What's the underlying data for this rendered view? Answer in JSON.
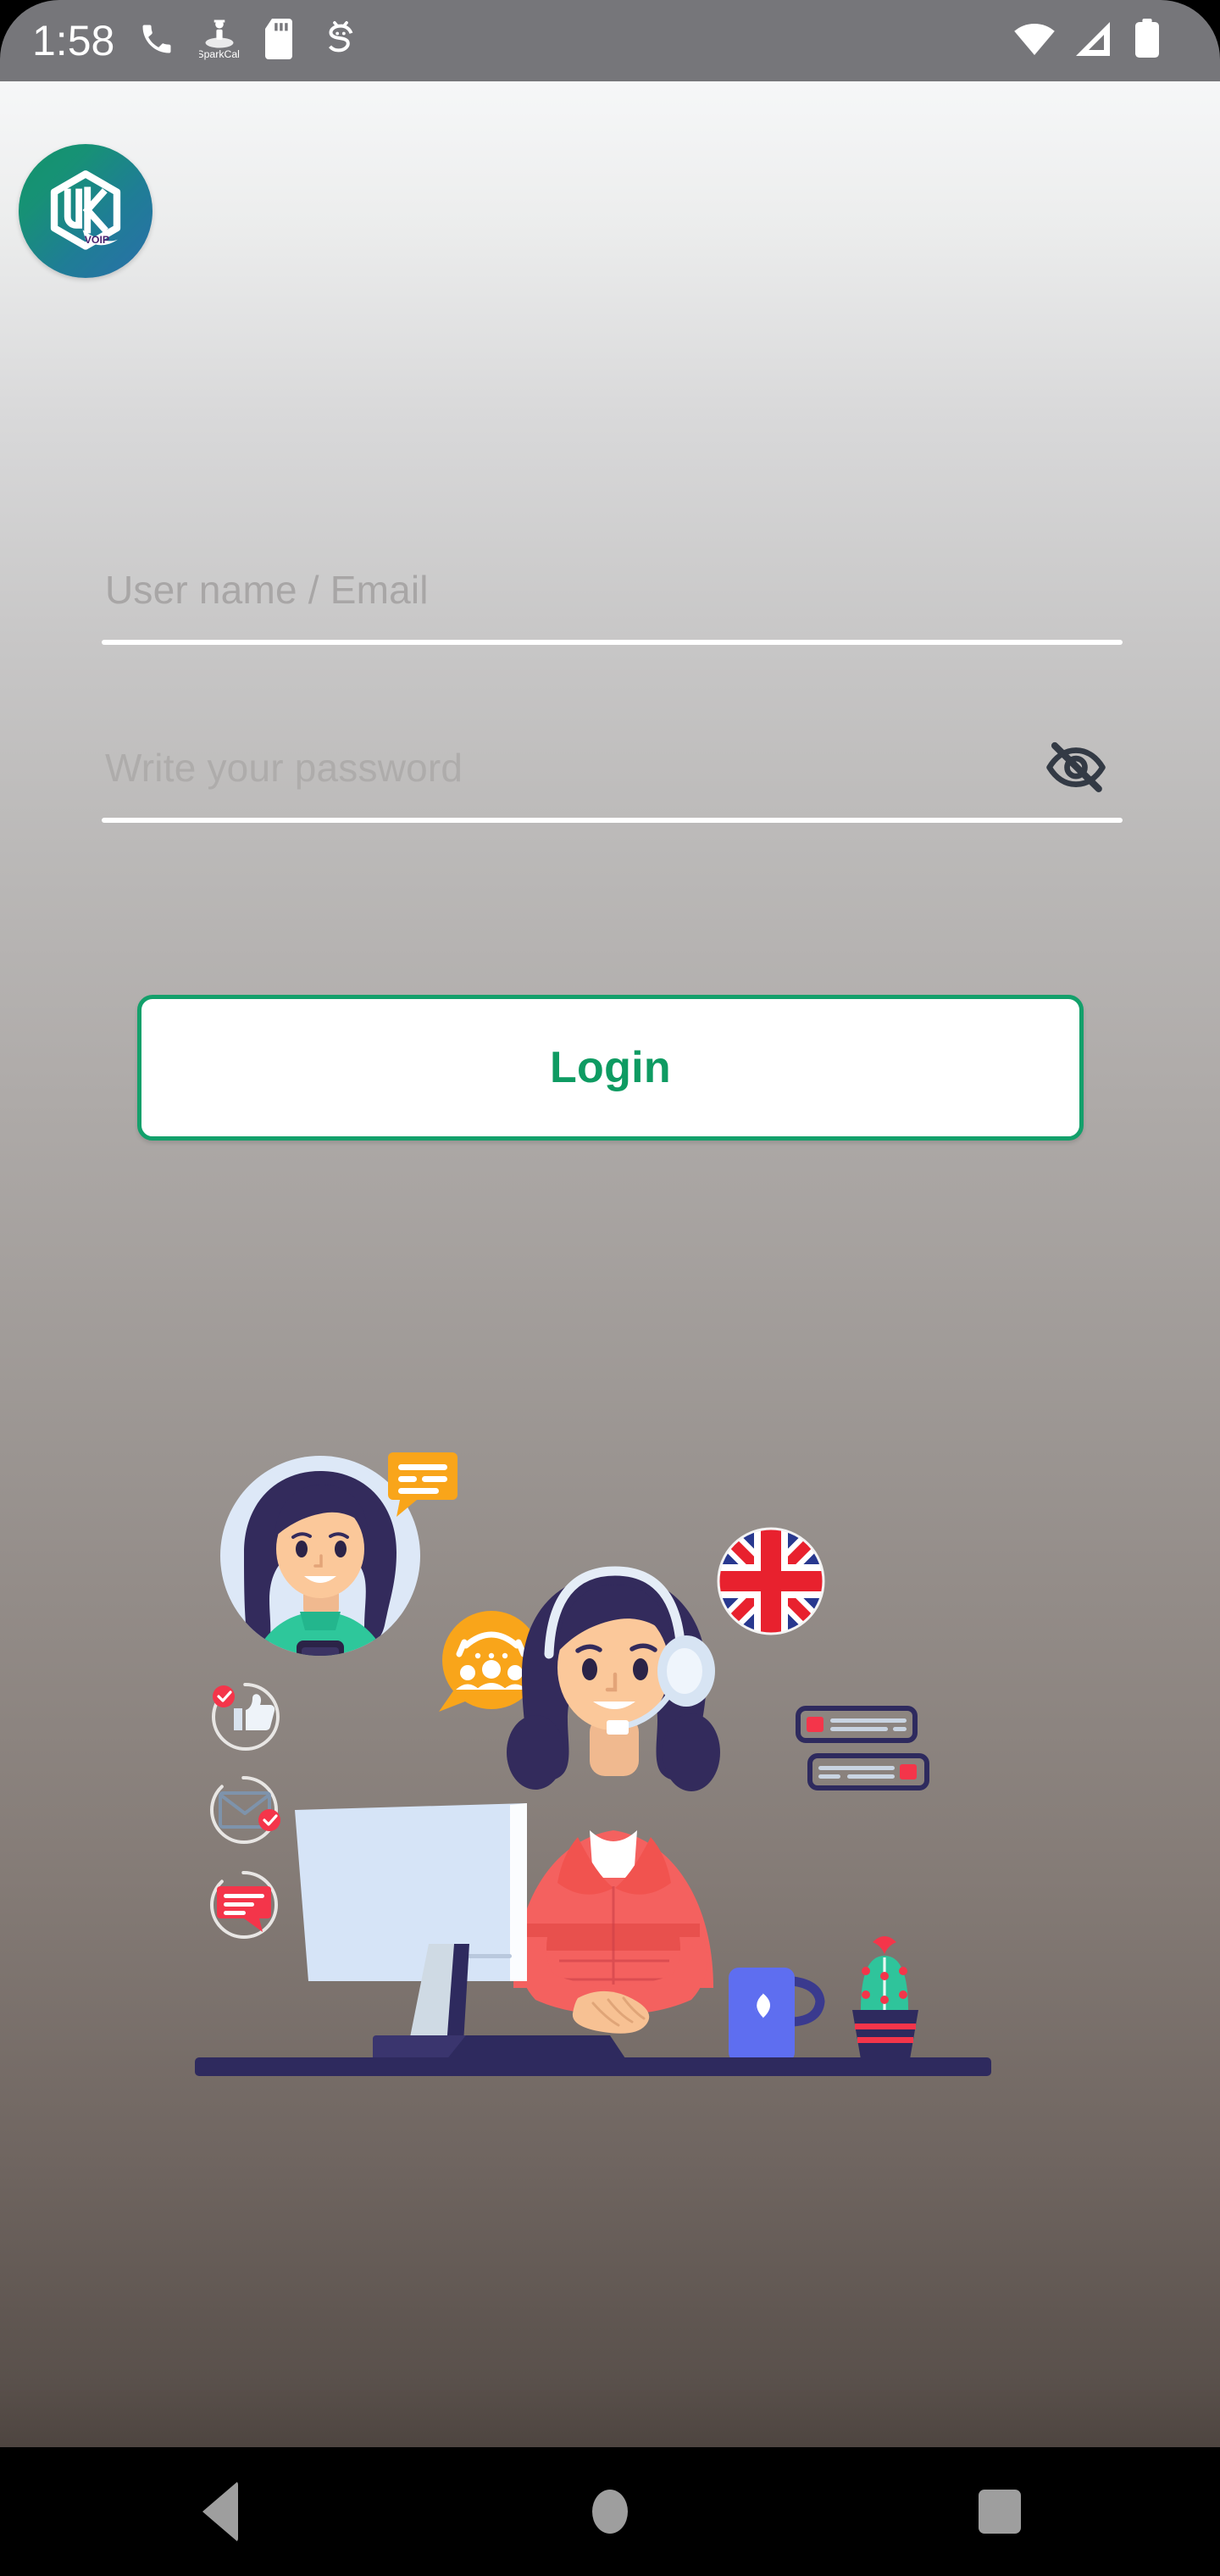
{
  "status_bar": {
    "time": "1:58",
    "left_icons": [
      {
        "name": "phone-icon",
        "label": "phone"
      },
      {
        "name": "sparkcall-icon",
        "label": "SparkCall"
      },
      {
        "name": "sd-card-icon",
        "label": "sd-card"
      },
      {
        "name": "android-debug-icon",
        "label": "android"
      }
    ],
    "right_icons": [
      {
        "name": "wifi-icon",
        "label": "wifi"
      },
      {
        "name": "cellular-signal-icon",
        "label": "signal"
      },
      {
        "name": "battery-icon",
        "label": "battery"
      }
    ]
  },
  "brand": {
    "logo_name": "uk-voip-logo",
    "logo_text": "VOIP",
    "gradient_start": "#12956a",
    "gradient_end": "#2a6faa"
  },
  "form": {
    "username": {
      "placeholder": "User name / Email",
      "value": ""
    },
    "password": {
      "placeholder": "Write your password",
      "value": "",
      "visibility_icon": "eye-off-icon",
      "visible": false
    },
    "login_label": "Login",
    "accent_color": "#0e9b62",
    "border_color": "#13a06b"
  },
  "illustration": {
    "name": "call-center-support-illustration",
    "elements": [
      {
        "name": "woman-with-phone-avatar",
        "label": "woman using smartphone"
      },
      {
        "name": "chat-bubble-badge",
        "label": "orange chat bubble"
      },
      {
        "name": "uk-flag-icon",
        "label": "United Kingdom flag"
      },
      {
        "name": "call-center-bubble-icon",
        "label": "orange call center bubble"
      },
      {
        "name": "thumbs-up-icon",
        "label": "thumbs up with check badge"
      },
      {
        "name": "envelope-icon",
        "label": "envelope with check badge"
      },
      {
        "name": "message-icon",
        "label": "red message bubble"
      },
      {
        "name": "support-agent",
        "label": "agent with headset"
      },
      {
        "name": "desktop-monitor",
        "label": "computer monitor"
      },
      {
        "name": "coffee-mug",
        "label": "blue coffee mug"
      },
      {
        "name": "cactus-plant",
        "label": "cactus in pot"
      },
      {
        "name": "chat-message-bar-top",
        "label": "message bar"
      },
      {
        "name": "chat-message-bar-bottom",
        "label": "message bar"
      }
    ],
    "colors": {
      "agent_suit": "#f4615f",
      "hair": "#332b5c",
      "accent_orange": "#f9a51a",
      "accent_red": "#f43b4e",
      "monitor": "#d6e4f7",
      "desk": "#2e2a5e",
      "mug": "#5e6ef0",
      "cactus": "#2fc49b"
    }
  },
  "nav_bar": {
    "buttons": [
      {
        "name": "nav-back-button",
        "label": "Back"
      },
      {
        "name": "nav-home-button",
        "label": "Home"
      },
      {
        "name": "nav-recents-button",
        "label": "Recents"
      }
    ]
  }
}
